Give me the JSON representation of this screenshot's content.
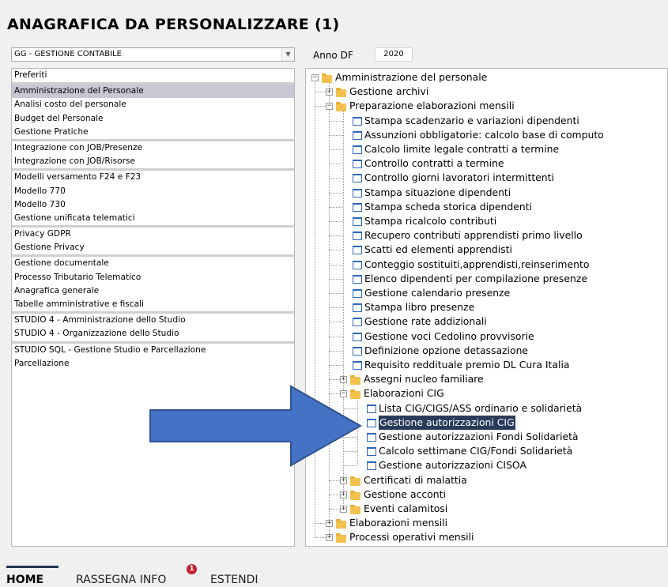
{
  "page_title": "ANAGRAFICA DA PERSONALIZZARE (1)",
  "module_select": {
    "value": "GG - GESTIONE CONTABILE",
    "arrow": "chevron-down-icon"
  },
  "anno": {
    "label": "Anno DF",
    "value": "2020"
  },
  "left_list": [
    {
      "label": "Preferiti",
      "sep": true
    },
    {
      "label": "Amministrazione del Personale",
      "selected": true
    },
    {
      "label": "Analisi costo del personale"
    },
    {
      "label": "Budget del Personale"
    },
    {
      "label": "Gestione Pratiche",
      "sep": true
    },
    {
      "label": "Integrazione con JOB/Presenze"
    },
    {
      "label": "Integrazione con JOB/Risorse",
      "sep": true
    },
    {
      "label": "Modelli versamento F24 e F23"
    },
    {
      "label": "Modello 770"
    },
    {
      "label": "Modello 730"
    },
    {
      "label": "Gestione unificata telematici",
      "sep": true
    },
    {
      "label": "Privacy GDPR"
    },
    {
      "label": "Gestione Privacy",
      "sep": true
    },
    {
      "label": "Gestione documentale"
    },
    {
      "label": "Processo Tributario Telematico"
    },
    {
      "label": "Anagrafica generale"
    },
    {
      "label": "Tabelle amministrative e fiscali",
      "sep": true
    },
    {
      "label": "STUDIO 4 - Amministrazione dello Studio"
    },
    {
      "label": "STUDIO 4 - Organizzazione dello Studio",
      "sep": true
    },
    {
      "label": "STUDIO SQL - Gestione Studio e Parcellazione"
    },
    {
      "label": "Parcellazione"
    }
  ],
  "tree": [
    {
      "label": "Amministrazione del personale",
      "level": 0,
      "type": "folder",
      "exp": "-"
    },
    {
      "label": "Gestione archivi",
      "level": 1,
      "type": "folder",
      "exp": "+"
    },
    {
      "label": "Preparazione elaborazioni mensili",
      "level": 1,
      "type": "folder",
      "exp": "-"
    },
    {
      "label": "Stampa scadenzario e variazioni dipendenti",
      "level": 2,
      "type": "doc"
    },
    {
      "label": "Assunzioni obbligatorie: calcolo base di computo",
      "level": 2,
      "type": "doc"
    },
    {
      "label": "Calcolo limite legale contratti a termine",
      "level": 2,
      "type": "doc"
    },
    {
      "label": "Controllo contratti a termine",
      "level": 2,
      "type": "doc"
    },
    {
      "label": "Controllo giorni lavoratori intermittenti",
      "level": 2,
      "type": "doc"
    },
    {
      "label": "Stampa situazione dipendenti",
      "level": 2,
      "type": "doc"
    },
    {
      "label": "Stampa scheda storica dipendenti",
      "level": 2,
      "type": "doc"
    },
    {
      "label": "Stampa ricalcolo contributi",
      "level": 2,
      "type": "doc"
    },
    {
      "label": "Recupero contributi apprendisti primo livello",
      "level": 2,
      "type": "doc"
    },
    {
      "label": "Scatti ed elementi apprendisti",
      "level": 2,
      "type": "doc"
    },
    {
      "label": "Conteggio sostituiti,apprendisti,reinserimento",
      "level": 2,
      "type": "doc"
    },
    {
      "label": "Elenco dipendenti per compilazione presenze",
      "level": 2,
      "type": "doc"
    },
    {
      "label": "Gestione calendario presenze",
      "level": 2,
      "type": "doc"
    },
    {
      "label": "Stampa libro presenze",
      "level": 2,
      "type": "doc"
    },
    {
      "label": "Gestione rate addizionali",
      "level": 2,
      "type": "doc"
    },
    {
      "label": "Gestione voci Cedolino provvisorie",
      "level": 2,
      "type": "doc"
    },
    {
      "label": "Definizione opzione detassazione",
      "level": 2,
      "type": "doc"
    },
    {
      "label": "Requisito reddituale premio DL Cura Italia",
      "level": 2,
      "type": "doc"
    },
    {
      "label": "Assegni nucleo familiare",
      "level": 2,
      "type": "folder",
      "exp": "+"
    },
    {
      "label": "Elaborazioni CIG",
      "level": 2,
      "type": "folder",
      "exp": "-"
    },
    {
      "label": "Lista CIG/CIGS/ASS ordinario e solidarietà",
      "level": 3,
      "type": "doc"
    },
    {
      "label": "Gestione autorizzazioni CIG",
      "level": 3,
      "type": "doc",
      "highlight": true
    },
    {
      "label": "Gestione autorizzazioni Fondi Solidarietà",
      "level": 3,
      "type": "doc"
    },
    {
      "label": "Calcolo settimane CIG/Fondi Solidarietà",
      "level": 3,
      "type": "doc"
    },
    {
      "label": "Gestione autorizzazioni CISOA",
      "level": 3,
      "type": "doc"
    },
    {
      "label": "Certificati di malattia",
      "level": 2,
      "type": "folder",
      "exp": "+"
    },
    {
      "label": "Gestione acconti",
      "level": 2,
      "type": "folder",
      "exp": "+"
    },
    {
      "label": "Eventi calamitosi",
      "level": 2,
      "type": "folder",
      "exp": "+"
    },
    {
      "label": "Elaborazioni mensili",
      "level": 1,
      "type": "folder",
      "exp": "+"
    },
    {
      "label": "Processi operativi mensili",
      "level": 1,
      "type": "folder",
      "exp": "+"
    }
  ],
  "footer_tabs": {
    "home": "HOME",
    "rassegna": "RASSEGNA INFO",
    "rassegna_badge": "1",
    "estendi": "ESTENDI"
  },
  "colors": {
    "arrow_fill": "#4472c4",
    "arrow_stroke": "#2f528f",
    "highlight": "#2a3b5a",
    "badge": "#c21f2e"
  }
}
